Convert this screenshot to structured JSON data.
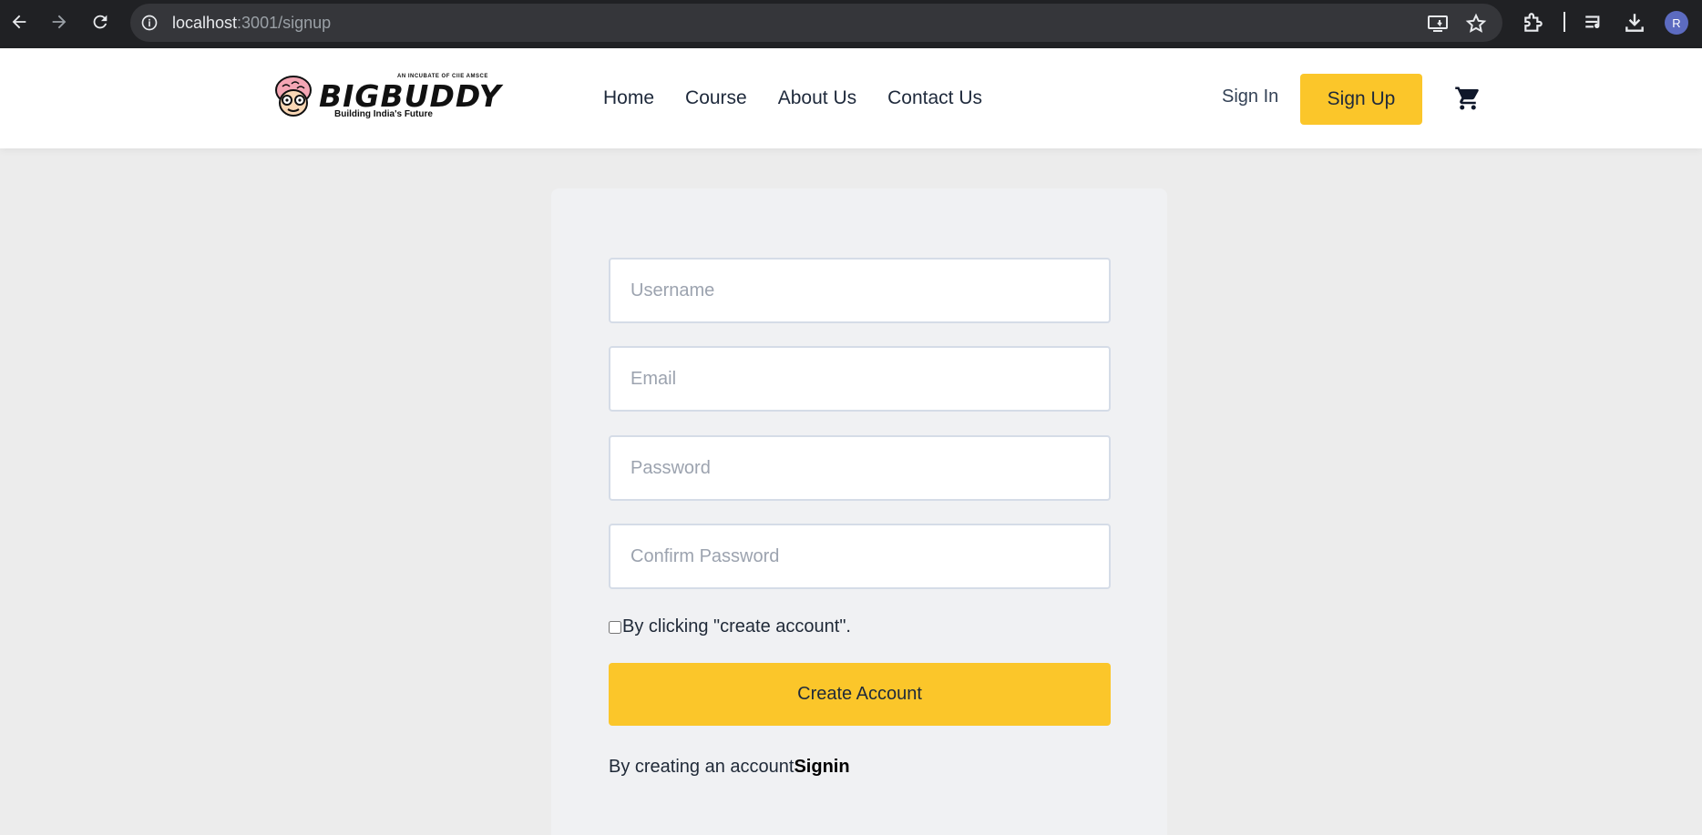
{
  "browser": {
    "url_host": "localhost",
    "url_path": ":3001/signup",
    "profile_initial": "R"
  },
  "header": {
    "logo": {
      "tagline_top": "AN INCUBATE OF CIIE AMSCE",
      "wordmark": "BIGBUDDY",
      "tagline": "Building India's Future"
    },
    "nav": [
      "Home",
      "Course",
      "About Us",
      "Contact Us"
    ],
    "signin_label": "Sign In",
    "signup_label": "Sign Up"
  },
  "form": {
    "username_placeholder": "Username",
    "email_placeholder": "Email",
    "password_placeholder": "Password",
    "confirm_placeholder": "Confirm Password",
    "terms_label": "By clicking \"create account\".",
    "submit_label": "Create Account",
    "footer_text": "By creating an account",
    "footer_link": "Signin"
  },
  "colors": {
    "accent": "#fbc62a",
    "page_bg": "#ececec",
    "card_bg": "#f0f1f3"
  }
}
